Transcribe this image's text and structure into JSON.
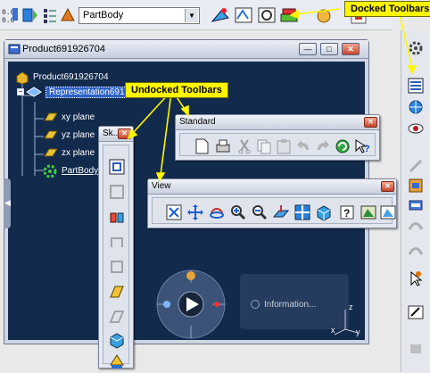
{
  "toolbar": {
    "current_body": "PartBody",
    "icons": [
      "measure-icon",
      "axis-system-icon",
      "tree-icon",
      "std-icon",
      "sketch-tools-icon",
      "view-mode-icon",
      "render-icon",
      "analysis-icon"
    ]
  },
  "window": {
    "title": "Product691926704",
    "buttons": {
      "minimize": "—",
      "maximize": "□",
      "close": "✕"
    }
  },
  "tree": {
    "root": "Product691926704",
    "representation": "Representation691",
    "children": [
      "xy plane",
      "yz plane",
      "zx plane",
      "PartBody"
    ]
  },
  "toolbars": {
    "sketcher": {
      "title": "Sk..."
    },
    "standard": {
      "title": "Standard"
    },
    "view": {
      "title": "View"
    }
  },
  "callouts": {
    "docked": "Docked Toolbars",
    "undocked": "Undocked Toolbars"
  },
  "info": {
    "label": "Information..."
  },
  "axes": {
    "x": "x",
    "y": "y",
    "z": "z"
  },
  "colors": {
    "callout": "#fff600",
    "viewport": "#122a4c",
    "selection": "#2d63c8"
  }
}
